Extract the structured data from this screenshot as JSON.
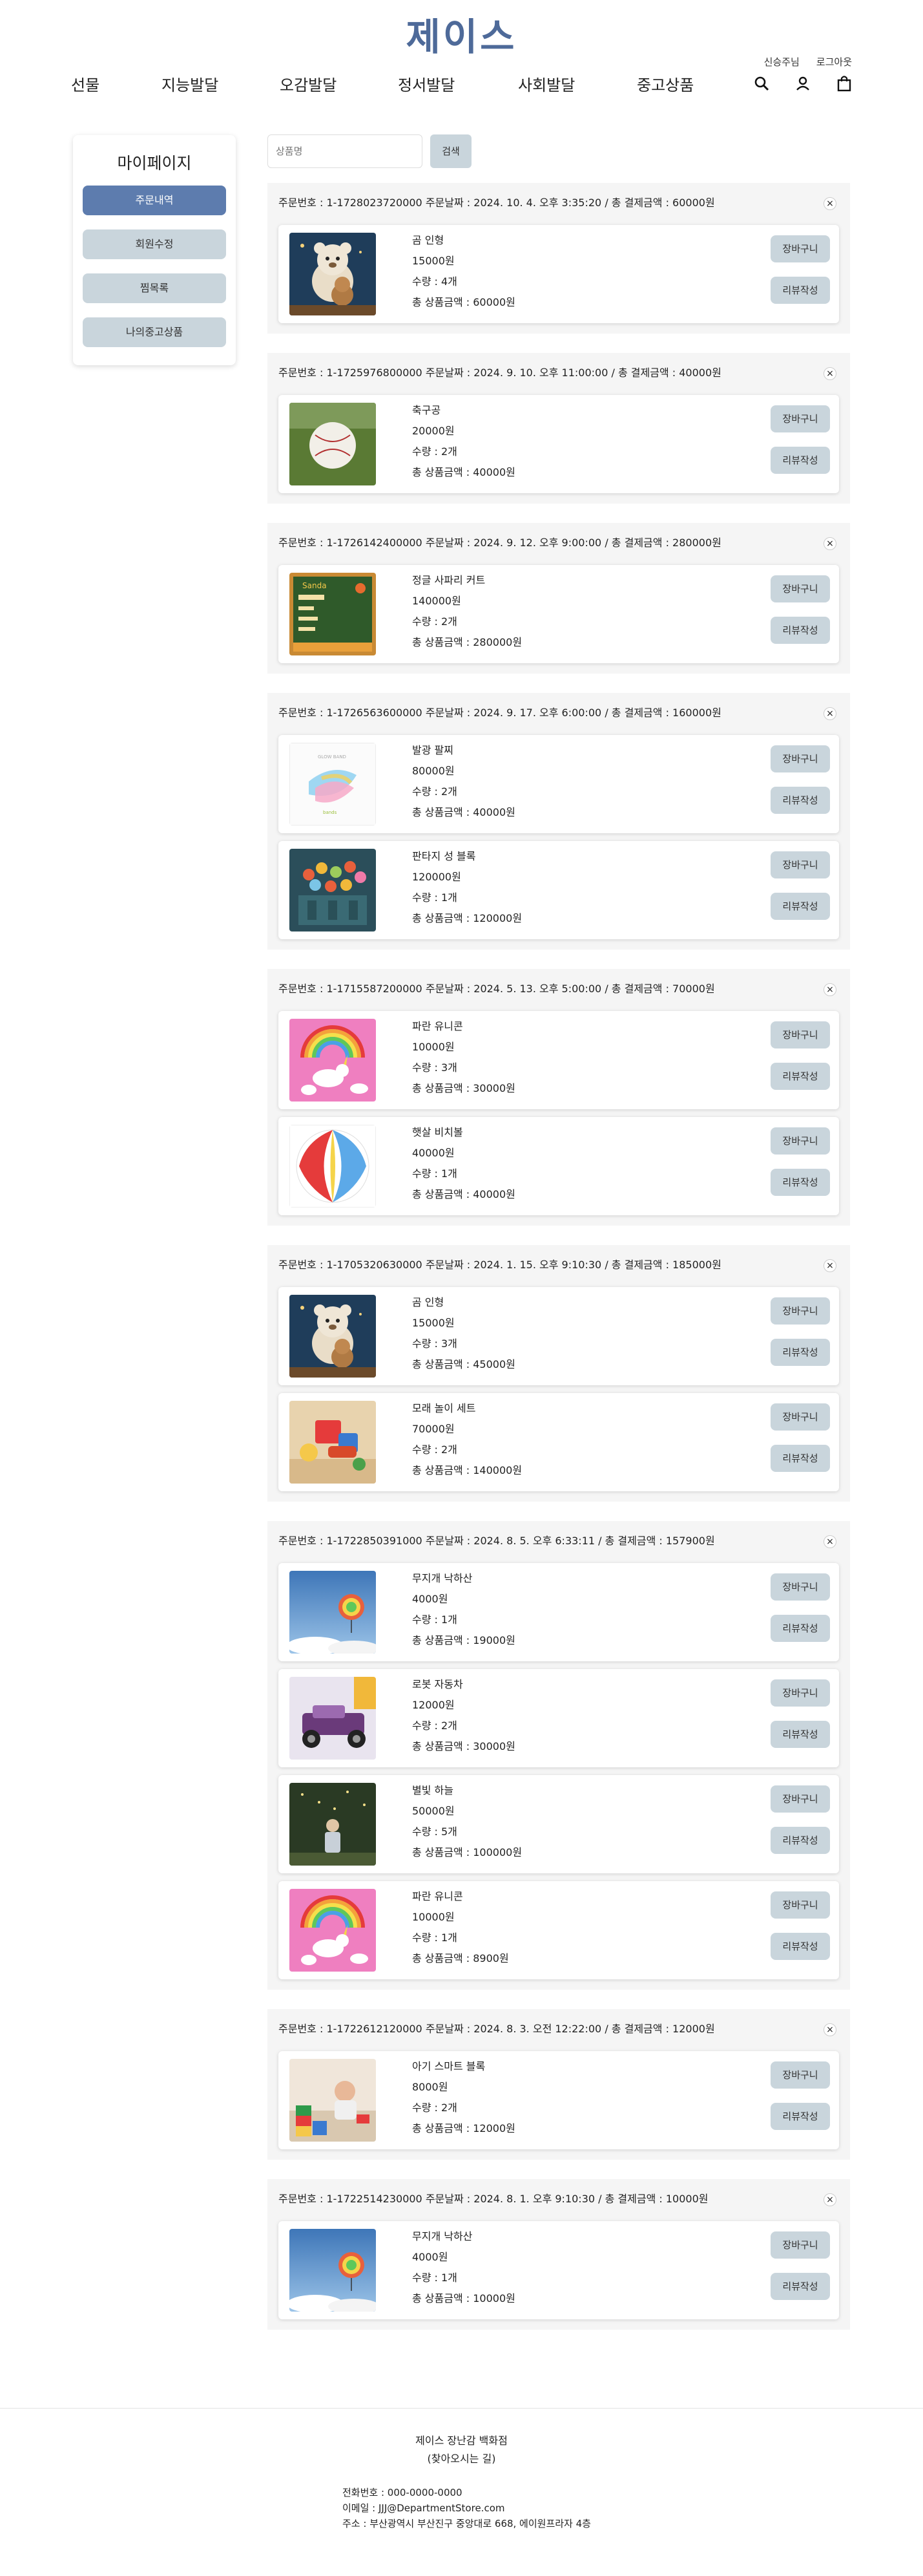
{
  "header": {
    "logo": "제이스",
    "user_links": [
      "신승주님",
      "로그아웃"
    ],
    "nav": [
      "선물",
      "지능발달",
      "오감발달",
      "정서발달",
      "사회발달",
      "중고상품"
    ],
    "icons": [
      "search-icon",
      "user-icon",
      "shopping-bag-icon"
    ]
  },
  "sidebar": {
    "title": "마이페이지",
    "items": [
      {
        "label": "주문내역",
        "active": true
      },
      {
        "label": "회원수정",
        "active": false
      },
      {
        "label": "찜목록",
        "active": false
      },
      {
        "label": "나의중고상품",
        "active": false
      }
    ]
  },
  "search": {
    "placeholder": "상품명",
    "button": "검색"
  },
  "labels": {
    "cart": "장바구니",
    "review": "리뷰작성",
    "close": "×"
  },
  "orders": [
    {
      "header": "주문번호 : 1-1728023720000 주문날짜 : 2024. 10. 4. 오후 3:35:20 / 총 결제금액 : 60000원",
      "items": [
        {
          "name": "곰 인형",
          "price": "15000원",
          "qty": "수량 : 4개",
          "total": "총 상품금액 : 60000원",
          "img": "teddy"
        }
      ]
    },
    {
      "header": "주문번호 : 1-1725976800000 주문날짜 : 2024. 9. 10. 오후 11:00:00 / 총 결제금액 : 40000원",
      "items": [
        {
          "name": "축구공",
          "price": "20000원",
          "qty": "수량 : 2개",
          "total": "총 상품금액 : 40000원",
          "img": "ball"
        }
      ]
    },
    {
      "header": "주문번호 : 1-1726142400000 주문날짜 : 2024. 9. 12. 오후 9:00:00 / 총 결제금액 : 280000원",
      "items": [
        {
          "name": "정글 사파리 커트",
          "price": "140000원",
          "qty": "수량 : 2개",
          "total": "총 상품금액 : 280000원",
          "img": "safari"
        }
      ]
    },
    {
      "header": "주문번호 : 1-1726563600000 주문날짜 : 2024. 9. 17. 오후 6:00:00 / 총 결제금액 : 160000원",
      "items": [
        {
          "name": "발광 팔찌",
          "price": "80000원",
          "qty": "수량 : 2개",
          "total": "총 상품금액 : 40000원",
          "img": "bracelet"
        },
        {
          "name": "판타지 성 블록",
          "price": "120000원",
          "qty": "수량 : 1개",
          "total": "총 상품금액 : 120000원",
          "img": "castle"
        }
      ]
    },
    {
      "header": "주문번호 : 1-1715587200000 주문날짜 : 2024. 5. 13. 오후 5:00:00 / 총 결제금액 : 70000원",
      "items": [
        {
          "name": "파란 유니콘",
          "price": "10000원",
          "qty": "수량 : 3개",
          "total": "총 상품금액 : 30000원",
          "img": "unicorn"
        },
        {
          "name": "햇살 비치볼",
          "price": "40000원",
          "qty": "수량 : 1개",
          "total": "총 상품금액 : 40000원",
          "img": "beachball"
        }
      ]
    },
    {
      "header": "주문번호 : 1-1705320630000 주문날짜 : 2024. 1. 15. 오후 9:10:30 / 총 결제금액 : 185000원",
      "items": [
        {
          "name": "곰 인형",
          "price": "15000원",
          "qty": "수량 : 3개",
          "total": "총 상품금액 : 45000원",
          "img": "teddy"
        },
        {
          "name": "모래 놀이 세트",
          "price": "70000원",
          "qty": "수량 : 2개",
          "total": "총 상품금액 : 140000원",
          "img": "sand"
        }
      ]
    },
    {
      "header": "주문번호 : 1-1722850391000 주문날짜 : 2024. 8. 5. 오후 6:33:11 / 총 결제금액 : 157900원",
      "items": [
        {
          "name": "무지개 낙하산",
          "price": "4000원",
          "qty": "수량 : 1개",
          "total": "총 상품금액 : 19000원",
          "img": "parachute"
        },
        {
          "name": "로봇 자동차",
          "price": "12000원",
          "qty": "수량 : 2개",
          "total": "총 상품금액 : 30000원",
          "img": "robotcar"
        },
        {
          "name": "별빛 하늘",
          "price": "50000원",
          "qty": "수량 : 5개",
          "total": "총 상품금액 : 100000원",
          "img": "starlight"
        },
        {
          "name": "파란 유니콘",
          "price": "10000원",
          "qty": "수량 : 1개",
          "total": "총 상품금액 : 8900원",
          "img": "unicorn"
        }
      ]
    },
    {
      "header": "주문번호 : 1-1722612120000 주문날짜 : 2024. 8. 3. 오전 12:22:00 / 총 결제금액 : 12000원",
      "items": [
        {
          "name": "아기 스마트 블록",
          "price": "8000원",
          "qty": "수량 : 2개",
          "total": "총 상품금액 : 12000원",
          "img": "blocks"
        }
      ]
    },
    {
      "header": "주문번호 : 1-1722514230000 주문날짜 : 2024. 8. 1. 오후 9:10:30 / 총 결제금액 : 10000원",
      "items": [
        {
          "name": "무지개 낙하산",
          "price": "4000원",
          "qty": "수량 : 1개",
          "total": "총 상품금액 : 10000원",
          "img": "parachute"
        }
      ]
    }
  ],
  "footer": {
    "name": "제이스 장난감 백화점",
    "subtitle": "(찾아오시는 길)",
    "phone": "전화번호 : 000-0000-0000",
    "email": "이메일 : JJJ@DepartmentStore.com",
    "address": "주소 : 부산광역시 부산진구 중앙대로 668, 에이원프라자 4층"
  }
}
